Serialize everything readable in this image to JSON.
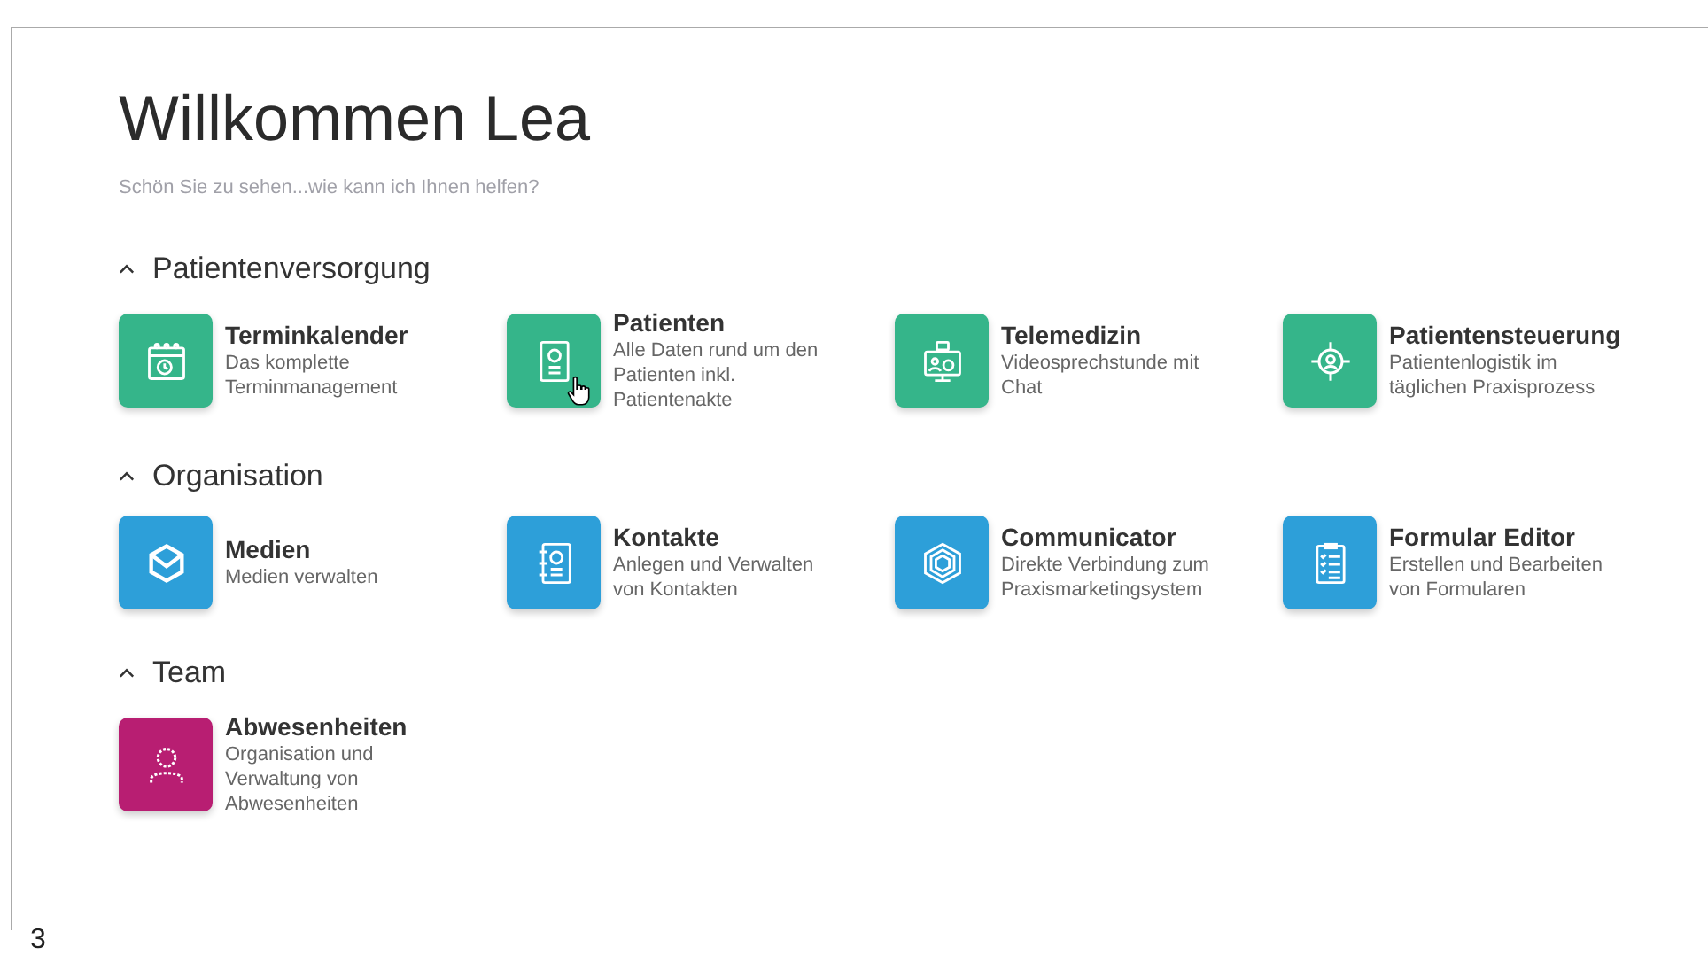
{
  "title": "Willkommen Lea",
  "subtitle": "Schön Sie zu sehen...wie kann ich Ihnen helfen?",
  "sections": [
    {
      "label": "Patientenversorgung",
      "expanded": true,
      "tiles": [
        {
          "kind": "calendar",
          "color": "#35b58a",
          "title": "Terminkalender",
          "description": "Das komplette Terminmanagement",
          "hovered": false
        },
        {
          "kind": "card",
          "color": "#35b58a",
          "title": "Patienten",
          "description": "Alle Daten rund um den Patienten inkl. Patientenakte",
          "hovered": true
        },
        {
          "kind": "video",
          "color": "#35b58a",
          "title": "Telemedizin",
          "description": "Videosprechstunde mit Chat",
          "hovered": false
        },
        {
          "kind": "target",
          "color": "#35b58a",
          "title": "Patientensteuerung",
          "description": "Patientenlogistik im täglichen Praxisprozess",
          "hovered": false
        }
      ]
    },
    {
      "label": "Organisation",
      "expanded": true,
      "tiles": [
        {
          "kind": "cube",
          "color": "#2d9fd9",
          "title": "Medien",
          "description": "Medien verwalten",
          "hovered": false
        },
        {
          "kind": "contacts",
          "color": "#2d9fd9",
          "title": "Kontakte",
          "description": "Anlegen und Verwalten von Kontakten",
          "hovered": false
        },
        {
          "kind": "hexagon",
          "color": "#2d9fd9",
          "title": "Communicator",
          "description": "Direkte Verbindung zum Praxismarketingsystem",
          "hovered": false
        },
        {
          "kind": "clipboard",
          "color": "#2d9fd9",
          "title": "Formular Editor",
          "description": "Erstellen und Bearbeiten von Formularen",
          "hovered": false
        }
      ]
    },
    {
      "label": "Team",
      "expanded": true,
      "tiles": [
        {
          "kind": "person",
          "color": "#b81e72",
          "title": "Abwesenheiten",
          "description": "Organisation und Verwaltung von Abwesenheiten",
          "hovered": false
        }
      ]
    }
  ],
  "footer_mark": "3"
}
